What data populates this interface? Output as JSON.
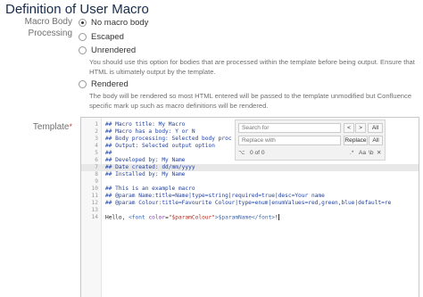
{
  "page": {
    "title": "Definition of User Macro"
  },
  "form": {
    "body_processing_label": "Macro Body Processing",
    "template_label": "Template",
    "required_marker": "*",
    "options": [
      {
        "label": "No macro body",
        "checked": true
      },
      {
        "label": "Escaped",
        "checked": false
      },
      {
        "label": "Unrendered",
        "checked": false
      },
      {
        "label": "Rendered",
        "checked": false
      }
    ],
    "unrendered_desc": "You should use this option for bodies that are processed within the template before being output. Ensure that HTML is ultimately output by the template.",
    "rendered_desc": "The body will be rendered so most HTML entered will be passed to the template unmodified but Confluence specific mark up such as macro definitions will be rendered."
  },
  "editor": {
    "active_line": 7,
    "lines": [
      {
        "n": "1",
        "text": "## Macro title: My Macro"
      },
      {
        "n": "2",
        "text": "## Macro has a body: Y or N"
      },
      {
        "n": "3",
        "text": "## Body processing: Selected body proc"
      },
      {
        "n": "4",
        "text": "## Output: Selected output option"
      },
      {
        "n": "5",
        "text": "##"
      },
      {
        "n": "6",
        "text": "## Developed by: My Name"
      },
      {
        "n": "7",
        "text": "## Date created: dd/mm/yyyy"
      },
      {
        "n": "8",
        "text": "## Installed by: My Name"
      },
      {
        "n": "9",
        "text": ""
      },
      {
        "n": "10",
        "text": "## This is an example macro"
      },
      {
        "n": "11",
        "text": "## @param Name:title=Name|type=string|required=true|desc=Your name"
      },
      {
        "n": "12",
        "text": "## @param Colour:title=Favourite Colour|type=enum|enumValues=red,green,blue|default=re"
      },
      {
        "n": "13",
        "text": ""
      },
      {
        "n": "14",
        "text": "Hello, <font color=\"$paramColour\">$paramName</font>!"
      }
    ],
    "last_line": {
      "t1": "Hello, ",
      "t2": "<font ",
      "t3": "color",
      "t4": "=",
      "t5": "\"$paramColour\"",
      "t6": ">$paramName",
      "t7": "</font>",
      "t8": "!"
    },
    "search": {
      "search_placeholder": "Search for",
      "replace_placeholder": "Replace with",
      "prev": "<",
      "next": ">",
      "all": "All",
      "replace": "Replace",
      "replace_all": "All",
      "count": "0 of 0",
      "match_case": "Aa",
      "regex": "\\b",
      "word": ".*"
    }
  }
}
